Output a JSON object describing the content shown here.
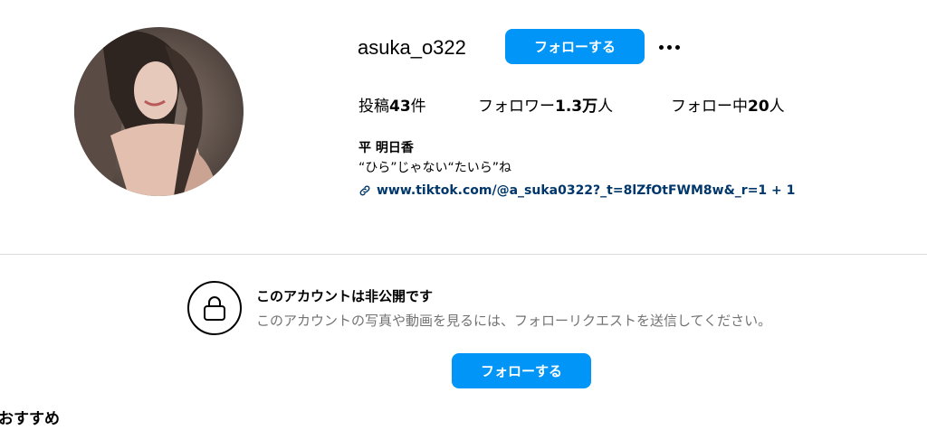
{
  "profile": {
    "username": "asuka_o322",
    "follow_label": "フォローする",
    "more_icon": "more-options-icon",
    "stats": {
      "posts_prefix": "投稿",
      "posts_value": "43",
      "posts_suffix": "件",
      "followers_prefix": "フォロワー",
      "followers_value": "1.3万",
      "followers_suffix": "人",
      "following_prefix": "フォロー中",
      "following_value": "20",
      "following_suffix": "人"
    },
    "full_name": "平 明日香",
    "bio": "“ひら”じゃない“たいら”ね",
    "link": "www.tiktok.com/@a_suka0322?_t=8lZfOtFWM8w&_r=1 + 1"
  },
  "private_notice": {
    "title": "このアカウントは非公開です",
    "description": "このアカウントの写真や動画を見るには、フォローリクエストを送信してください。",
    "follow_label": "フォローする"
  },
  "suggestions": {
    "heading": "おすすめ"
  },
  "colors": {
    "accent": "#0095f6",
    "link": "#00376b",
    "muted": "#737373",
    "divider": "#dbdbdb"
  }
}
